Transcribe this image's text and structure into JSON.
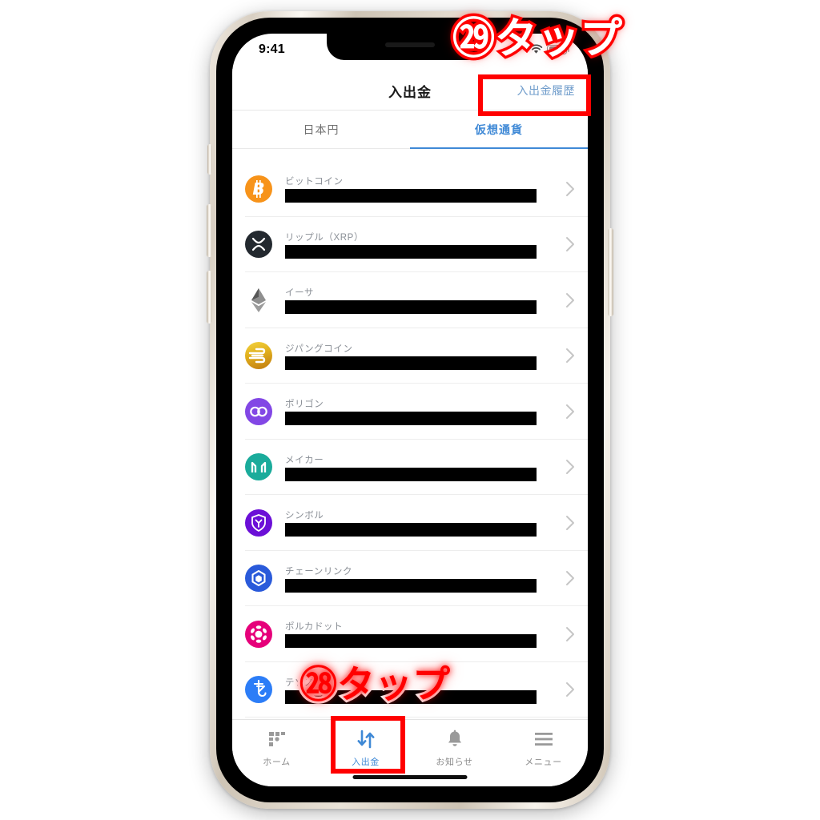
{
  "device": {
    "status_bar": {
      "time": "9:41",
      "wifi_icon": "wifi-icon",
      "battery_icon": "battery-icon"
    },
    "home_indicator": "home-indicator"
  },
  "header": {
    "title": "入出金",
    "action_label": "入出金履歴"
  },
  "tabs": [
    {
      "label": "日本円",
      "active": false
    },
    {
      "label": "仮想通貨",
      "active": true
    }
  ],
  "coins": [
    {
      "name": "ビットコイン",
      "icon": "bitcoin-icon",
      "color": "#F7931A",
      "redacted": true
    },
    {
      "name": "リップル（XRP）",
      "icon": "xrp-icon",
      "color": "#23292F",
      "redacted": true
    },
    {
      "name": "イーサ",
      "icon": "ethereum-icon",
      "color": "#6B7280",
      "redacted": true
    },
    {
      "name": "ジパングコイン",
      "icon": "jpyc-icon",
      "color": "#D99A1E",
      "redacted": true
    },
    {
      "name": "ポリゴン",
      "icon": "polygon-icon",
      "color": "#8247E5",
      "redacted": true
    },
    {
      "name": "メイカー",
      "icon": "maker-icon",
      "color": "#1AAB9B",
      "redacted": true
    },
    {
      "name": "シンボル",
      "icon": "symbol-icon",
      "color": "#6B0FD7",
      "redacted": true
    },
    {
      "name": "チェーンリンク",
      "icon": "chainlink-icon",
      "color": "#2A5ADA",
      "redacted": true
    },
    {
      "name": "ポルカドット",
      "icon": "polkadot-icon",
      "color": "#E6007A",
      "redacted": true
    },
    {
      "name": "テゾス",
      "icon": "tezos-icon",
      "color": "#2C7DF7",
      "redacted": true
    }
  ],
  "chevron_icon": "chevron-right-icon",
  "bottom_nav": [
    {
      "label": "ホーム",
      "icon": "grid-icon",
      "active": false
    },
    {
      "label": "入出金",
      "icon": "transfer-arrows-icon",
      "active": true
    },
    {
      "label": "お知らせ",
      "icon": "bell-icon",
      "active": false
    },
    {
      "label": "メニュー",
      "icon": "hamburger-icon",
      "active": false
    }
  ],
  "annotations": {
    "accent_color": "#FF0000",
    "callouts": [
      {
        "id": "callout-29",
        "text": "㉙タップ",
        "target": "入出金履歴"
      },
      {
        "id": "callout-28",
        "text": "㉘タップ",
        "target": "入出金"
      }
    ],
    "highlight_boxes": [
      {
        "name": "highlight-history-button"
      },
      {
        "name": "highlight-tabbar-transfer"
      }
    ]
  }
}
